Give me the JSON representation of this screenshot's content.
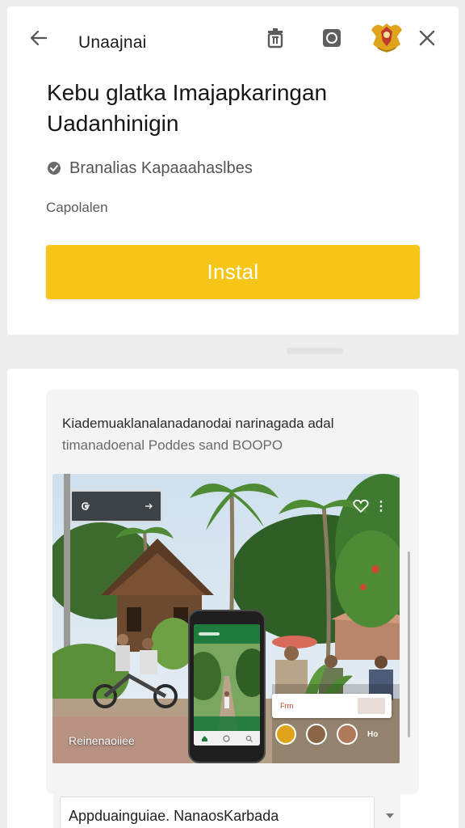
{
  "topbar": {
    "title": "Unaajnai"
  },
  "app": {
    "title": "Kebu glatka Imajapkaringan Uadanhinigin",
    "publisher": "Branalias Kapaaahaslbes",
    "category": "Capolalen",
    "install_label": "Instal"
  },
  "description": {
    "line1": "Kiademuaklanalanadanodai narinagada adal",
    "line2": "timanadoenal Poddes sand BOOPO"
  },
  "photo": {
    "caption": "Reinenaoiiee",
    "overlay_text": "Frrn",
    "avatar_label": "Ho"
  },
  "select": {
    "value": "Appduainguiae. NanaosKarbada"
  },
  "colors": {
    "install_bg": "#f5c518",
    "accent_green": "#1f7a3e"
  },
  "icons": {
    "back": "arrow-left-icon",
    "trash": "trash-icon",
    "shield": "shield-icon",
    "emblem": "emblem-icon",
    "close": "close-icon",
    "verified": "verified-icon",
    "dropdown": "chevron-down-icon"
  }
}
